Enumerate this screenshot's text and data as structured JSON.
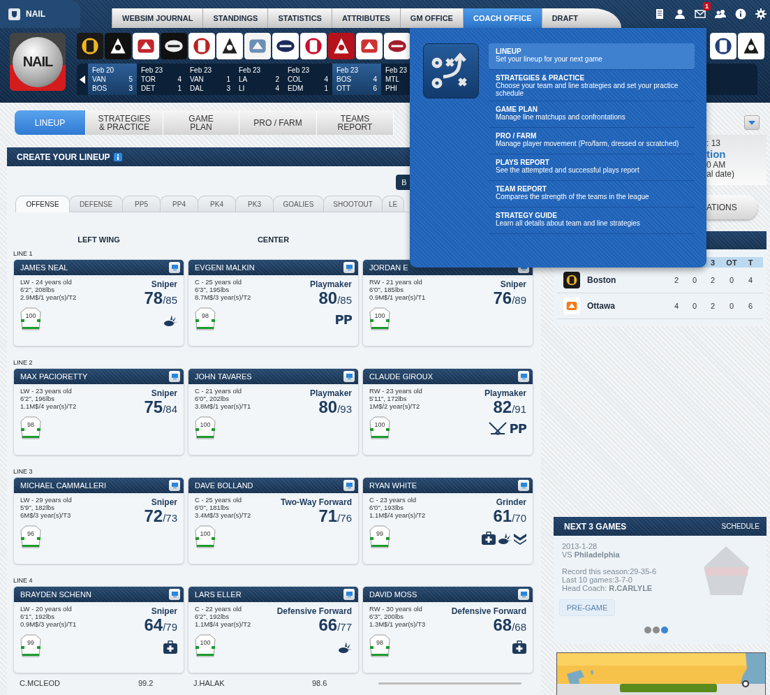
{
  "brand": {
    "title": "NAIL",
    "logo_text": "NAIL"
  },
  "nav_tabs": [
    {
      "label": "WEBSIM JOURNAL",
      "selected": false
    },
    {
      "label": "STANDINGS",
      "selected": false
    },
    {
      "label": "STATISTICS",
      "selected": false
    },
    {
      "label": "ATTRIBUTES",
      "selected": false
    },
    {
      "label": "GM OFFICE",
      "selected": false
    },
    {
      "label": "COACH OFFICE",
      "selected": true
    },
    {
      "label": "DRAFT",
      "selected": false
    }
  ],
  "mail_badge": "1",
  "scores": [
    {
      "date": "Feb 20",
      "highlighted": true,
      "team1": "VAN",
      "score1": "5",
      "team2": "BOS",
      "score2": "3"
    },
    {
      "date": "Feb 23",
      "highlighted": false,
      "team1": "TOR",
      "score1": "4",
      "team2": "DET",
      "score2": "1"
    },
    {
      "date": "Feb 23",
      "highlighted": false,
      "team1": "VAN",
      "score1": "1",
      "team2": "DAL",
      "score2": "3"
    },
    {
      "date": "Feb 23",
      "highlighted": false,
      "team1": "LA",
      "score1": "2",
      "team2": "LI",
      "score2": "4"
    },
    {
      "date": "Feb 23",
      "highlighted": false,
      "team1": "COL",
      "score1": "4",
      "team2": "EDM",
      "score2": "1"
    },
    {
      "date": "Feb 23",
      "highlighted": true,
      "team1": "BOS",
      "score1": "4",
      "team2": "OTT",
      "score2": "6"
    },
    {
      "date": "Feb 23",
      "highlighted": false,
      "team1": "MTL",
      "team2": "PHI"
    }
  ],
  "menu": {
    "items": [
      {
        "title": "LINEUP",
        "description": "Set your lineup for your next game",
        "selected": true
      },
      {
        "title": "STRATEGIES & PRACTICE",
        "description": "Choose your team and line strategies and set your practice schedule",
        "selected": false
      },
      {
        "title": "GAME PLAN",
        "description": "Manage line matchups and confrontations",
        "selected": false
      },
      {
        "title": "PRO / FARM",
        "description": "Manage player movement (Pro/farm, dressed or scratched)",
        "selected": false
      },
      {
        "title": "PLAYS REPORT",
        "description": "See the attempted and successful plays report",
        "selected": false
      },
      {
        "title": "TEAM REPORT",
        "description": "Compares the strength of the teams in the league",
        "selected": false
      },
      {
        "title": "STRATEGY GUIDE",
        "description": "Learn all details about team and line strategies",
        "selected": false
      }
    ]
  },
  "sub_tabs": [
    {
      "label": "LINEUP",
      "selected": true
    },
    {
      "label": "STRATEGIES\n& PRACTICE",
      "selected": false
    },
    {
      "label": "GAME\nPLAN",
      "selected": false
    },
    {
      "label": "PRO / FARM",
      "selected": false
    },
    {
      "label": "TEAMS\nREPORT",
      "selected": false
    }
  ],
  "lineup": {
    "title": "CREATE YOUR LINEUP",
    "button": "B",
    "tabs": [
      {
        "label": "OFFENSE",
        "selected": true
      },
      {
        "label": "DEFENSE",
        "selected": false
      },
      {
        "label": "PP5",
        "selected": false
      },
      {
        "label": "PP4",
        "selected": false
      },
      {
        "label": "PK4",
        "selected": false
      },
      {
        "label": "PK3",
        "selected": false
      },
      {
        "label": "GOALIES",
        "selected": false
      },
      {
        "label": "SHOOTOUT",
        "selected": false
      },
      {
        "label": "LE",
        "selected": false
      }
    ],
    "column_headings": [
      "LEFT WING",
      "CENTER"
    ],
    "lines": [
      {
        "label": "LINE 1",
        "players": [
          {
            "name": "JAMES NEAL",
            "details": [
              "LW - 24 years old",
              "6'2\", 208lbs",
              "2.9M$/1 year(s)/T2"
            ],
            "role": "Sniper",
            "rating": "78",
            "potential": "/85",
            "jersey": "100",
            "badges": [
              {
                "kind": "splash"
              }
            ]
          },
          {
            "name": "EVGENI MALKIN",
            "details": [
              "C - 25 years old",
              "6'3\", 195lbs",
              "8.7M$/3 year(s)/T2"
            ],
            "role": "Playmaker",
            "rating": "80",
            "potential": "/85",
            "jersey": "98",
            "badges": [
              {
                "kind": "pp",
                "label": "PP"
              }
            ]
          },
          {
            "name": "JORDAN E",
            "details": [
              "RW - 21 years old",
              "6'0\", 185lbs",
              "0.9M$/1 year(s)/T1"
            ],
            "role": "Sniper",
            "rating": "76",
            "potential": "/89",
            "jersey": "100"
          }
        ]
      },
      {
        "label": "LINE 2",
        "players": [
          {
            "name": "MAX PACIORETTY",
            "details": [
              "LW - 23 years old",
              "6'2\", 196lbs",
              "1.1M$/4 year(s)/T2"
            ],
            "role": "Sniper",
            "rating": "75",
            "potential": "/84",
            "jersey": "98"
          },
          {
            "name": "JOHN TAVARES",
            "details": [
              "C - 21 years old",
              "6'0\", 202lbs",
              "3.8M$/1 year(s)/T1"
            ],
            "role": "Playmaker",
            "rating": "80",
            "potential": "/93",
            "jersey": "100"
          },
          {
            "name": "CLAUDE GIROUX",
            "details": [
              "RW - 23 years old",
              "5'11\", 172lbs",
              "1M$/2 year(s)/T2"
            ],
            "role": "Playmaker",
            "rating": "82",
            "potential": "/91",
            "jersey": "100",
            "badges": [
              {
                "kind": "sticks"
              },
              {
                "kind": "pp",
                "label": "PP"
              }
            ]
          }
        ]
      },
      {
        "label": "LINE 3",
        "players": [
          {
            "name": "MICHAEL CAMMALLERI",
            "details": [
              "LW - 29 years old",
              "5'9\", 182lbs",
              "6M$/3 year(s)/T3"
            ],
            "role": "Sniper",
            "rating": "72",
            "potential": "/73",
            "jersey": "96"
          },
          {
            "name": "DAVE BOLLAND",
            "details": [
              "C - 25 years old",
              "6'0\", 181lbs",
              "3.4M$/3 year(s)/T2"
            ],
            "role": "Two-Way Forward",
            "rating": "71",
            "potential": "/76",
            "jersey": "100"
          },
          {
            "name": "RYAN WHITE",
            "details": [
              "C - 23 years old",
              "6'0\", 193lbs",
              "1.1M$/4 year(s)/T2"
            ],
            "role": "Grinder",
            "rating": "61",
            "potential": "/70",
            "jersey": "99",
            "badges": [
              {
                "kind": "medkit"
              },
              {
                "kind": "splash"
              },
              {
                "kind": "chevrons"
              }
            ]
          }
        ]
      },
      {
        "label": "LINE 4",
        "players": [
          {
            "name": "BRAYDEN SCHENN",
            "details": [
              "LW - 20 years old",
              "6'1\", 192lbs",
              "0.9M$/3 year(s)/T1"
            ],
            "role": "Sniper",
            "rating": "64",
            "potential": "/79",
            "jersey": "99",
            "badges": [
              {
                "kind": "medkit"
              }
            ]
          },
          {
            "name": "LARS ELLER",
            "details": [
              "C - 22 years old",
              "6'2\", 192lbs",
              "1.1M$/4 year(s)/T2"
            ],
            "role": "Defensive Forward",
            "rating": "66",
            "potential": "/77",
            "jersey": "100",
            "badges": [
              {
                "kind": "splash"
              }
            ]
          },
          {
            "name": "DAVID MOSS",
            "details": [
              "RW - 30 years old",
              "6'3\", 200lbs",
              "1.3M$/1 year(s)/T3"
            ],
            "role": "Defensive Forward",
            "rating": "68",
            "potential": "/68",
            "jersey": "98",
            "badges": [
              {
                "kind": "medkit"
              }
            ]
          }
        ]
      }
    ],
    "footer_rows": [
      {
        "name": "C.MCLEOD",
        "value": "99.2"
      },
      {
        "name": "J.HALAK",
        "value": "98.6"
      }
    ]
  },
  "event": {
    "countdown": ": 13",
    "title": "tion",
    "time": "0 AM",
    "note": "al date)",
    "button": "ATIONS"
  },
  "boxscore": {
    "columns": [
      "3",
      "OT",
      "T"
    ],
    "rows": [
      {
        "team": "Boston",
        "scores": [
          "2",
          "0",
          "2",
          "0",
          "4"
        ]
      },
      {
        "team": "Ottawa",
        "scores": [
          "4",
          "0",
          "2",
          "0",
          "6"
        ]
      }
    ]
  },
  "next_games": {
    "title": "NEXT 3 GAMES",
    "link": "SCHEDULE",
    "date": "2013-1-28",
    "opponent": "VS **Philadelphia**",
    "record": "Record this season:29-35-6",
    "last10": "Last 10 games:3-7-0",
    "coach": "Head Coach: **R.CARLYLE**",
    "button": "PRE-GAME",
    "pages": [
      {
        "selected": false
      },
      {
        "selected": false
      },
      {
        "selected": true
      }
    ]
  }
}
